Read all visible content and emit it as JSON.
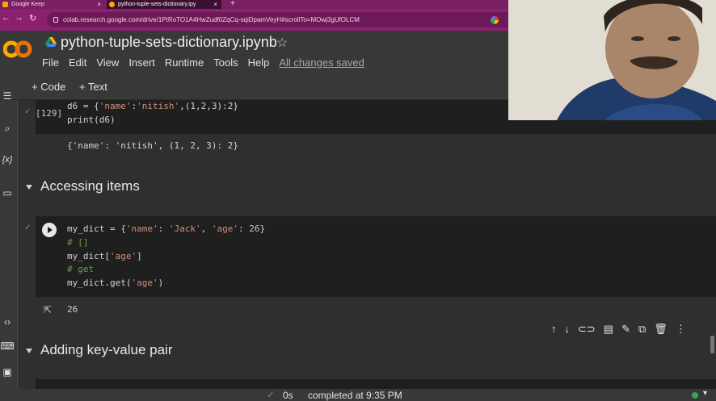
{
  "browser": {
    "tabs": [
      {
        "title": "Google Keep"
      },
      {
        "title": "python-tuple-sets-dictionary.ipy"
      }
    ],
    "url": "colab.research.google.com/drive/1PtRoTO1A4HwZudf0ZqCq-sqiDpamVeyH#scrollTo=MOwj3gUfOLCM"
  },
  "header": {
    "logo_text": "CO",
    "notebook_title": "python-tuple-sets-dictionary.ipynb",
    "menu": [
      "File",
      "Edit",
      "View",
      "Insert",
      "Runtime",
      "Tools",
      "Help"
    ],
    "save_status": "All changes saved"
  },
  "toolbar": {
    "add_code": "+ Code",
    "add_text": "+ Text"
  },
  "cells": {
    "cell1": {
      "exec_count": "[129]",
      "line1": {
        "a": "d6 = {",
        "b": "'name'",
        "c": ":",
        "d": "'nitish'",
        "e": ",(1,2,3):2}"
      },
      "line2": "print(d6)",
      "output": "{'name': 'nitish', (1, 2, 3): 2}"
    },
    "section1": "Accessing items",
    "cell2": {
      "line1": {
        "a": "my_dict = {",
        "b": "'name'",
        "c": ": ",
        "d": "'Jack'",
        "e": ", ",
        "f": "'age'",
        "g": ": ",
        "h": "26",
        "i": "}"
      },
      "line2": "# []",
      "line3": {
        "a": "my_dict[",
        "b": "'age'",
        "c": "]"
      },
      "line4": "# get",
      "line5": {
        "a": "my_dict.get(",
        "b": "'age'",
        "c": ")"
      },
      "output": "26"
    },
    "section2": "Adding key-value pair"
  },
  "status": {
    "duration": "0s",
    "completed": "completed at 9:35 PM"
  }
}
